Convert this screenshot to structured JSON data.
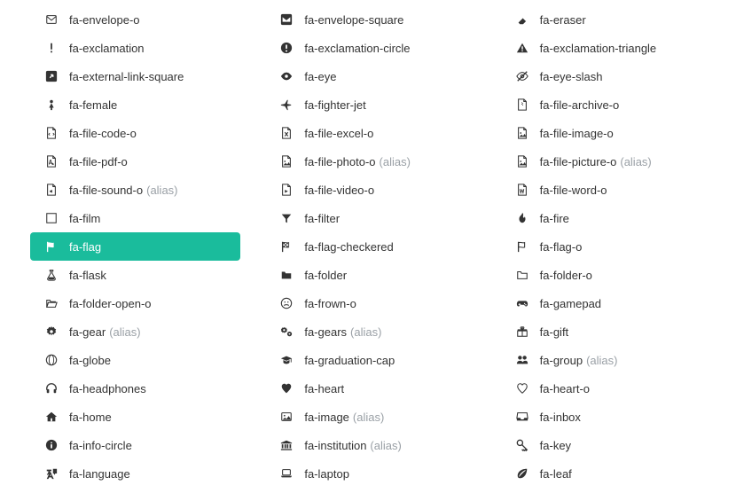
{
  "alias_suffix": "(alias)",
  "columns": [
    [
      {
        "name": "fa-envelope-o",
        "icon": "envelope-o",
        "alias": false,
        "selected": false
      },
      {
        "name": "fa-exclamation",
        "icon": "exclamation",
        "alias": false,
        "selected": false
      },
      {
        "name": "fa-external-link-square",
        "icon": "external-link-square",
        "alias": false,
        "selected": false
      },
      {
        "name": "fa-female",
        "icon": "female",
        "alias": false,
        "selected": false
      },
      {
        "name": "fa-file-code-o",
        "icon": "file-code-o",
        "alias": false,
        "selected": false
      },
      {
        "name": "fa-file-pdf-o",
        "icon": "file-pdf-o",
        "alias": false,
        "selected": false
      },
      {
        "name": "fa-file-sound-o",
        "icon": "file-sound-o",
        "alias": true,
        "selected": false
      },
      {
        "name": "fa-film",
        "icon": "film",
        "alias": false,
        "selected": false
      },
      {
        "name": "fa-flag",
        "icon": "flag",
        "alias": false,
        "selected": true
      },
      {
        "name": "fa-flask",
        "icon": "flask",
        "alias": false,
        "selected": false
      },
      {
        "name": "fa-folder-open-o",
        "icon": "folder-open-o",
        "alias": false,
        "selected": false
      },
      {
        "name": "fa-gear",
        "icon": "gear",
        "alias": true,
        "selected": false
      },
      {
        "name": "fa-globe",
        "icon": "globe",
        "alias": false,
        "selected": false
      },
      {
        "name": "fa-headphones",
        "icon": "headphones",
        "alias": false,
        "selected": false
      },
      {
        "name": "fa-home",
        "icon": "home",
        "alias": false,
        "selected": false
      },
      {
        "name": "fa-info-circle",
        "icon": "info-circle",
        "alias": false,
        "selected": false
      },
      {
        "name": "fa-language",
        "icon": "language",
        "alias": false,
        "selected": false
      }
    ],
    [
      {
        "name": "fa-envelope-square",
        "icon": "envelope-square",
        "alias": false,
        "selected": false
      },
      {
        "name": "fa-exclamation-circle",
        "icon": "exclamation-circle",
        "alias": false,
        "selected": false
      },
      {
        "name": "fa-eye",
        "icon": "eye",
        "alias": false,
        "selected": false
      },
      {
        "name": "fa-fighter-jet",
        "icon": "fighter-jet",
        "alias": false,
        "selected": false
      },
      {
        "name": "fa-file-excel-o",
        "icon": "file-excel-o",
        "alias": false,
        "selected": false
      },
      {
        "name": "fa-file-photo-o",
        "icon": "file-photo-o",
        "alias": true,
        "selected": false
      },
      {
        "name": "fa-file-video-o",
        "icon": "file-video-o",
        "alias": false,
        "selected": false
      },
      {
        "name": "fa-filter",
        "icon": "filter",
        "alias": false,
        "selected": false
      },
      {
        "name": "fa-flag-checkered",
        "icon": "flag-checkered",
        "alias": false,
        "selected": false
      },
      {
        "name": "fa-folder",
        "icon": "folder",
        "alias": false,
        "selected": false
      },
      {
        "name": "fa-frown-o",
        "icon": "frown-o",
        "alias": false,
        "selected": false
      },
      {
        "name": "fa-gears",
        "icon": "gears",
        "alias": true,
        "selected": false
      },
      {
        "name": "fa-graduation-cap",
        "icon": "graduation-cap",
        "alias": false,
        "selected": false
      },
      {
        "name": "fa-heart",
        "icon": "heart",
        "alias": false,
        "selected": false
      },
      {
        "name": "fa-image",
        "icon": "image",
        "alias": true,
        "selected": false
      },
      {
        "name": "fa-institution",
        "icon": "institution",
        "alias": true,
        "selected": false
      },
      {
        "name": "fa-laptop",
        "icon": "laptop",
        "alias": false,
        "selected": false
      }
    ],
    [
      {
        "name": "fa-eraser",
        "icon": "eraser",
        "alias": false,
        "selected": false
      },
      {
        "name": "fa-exclamation-triangle",
        "icon": "exclamation-triangle",
        "alias": false,
        "selected": false
      },
      {
        "name": "fa-eye-slash",
        "icon": "eye-slash",
        "alias": false,
        "selected": false
      },
      {
        "name": "fa-file-archive-o",
        "icon": "file-archive-o",
        "alias": false,
        "selected": false
      },
      {
        "name": "fa-file-image-o",
        "icon": "file-image-o",
        "alias": false,
        "selected": false
      },
      {
        "name": "fa-file-picture-o",
        "icon": "file-picture-o",
        "alias": true,
        "selected": false
      },
      {
        "name": "fa-file-word-o",
        "icon": "file-word-o",
        "alias": false,
        "selected": false
      },
      {
        "name": "fa-fire",
        "icon": "fire",
        "alias": false,
        "selected": false
      },
      {
        "name": "fa-flag-o",
        "icon": "flag-o",
        "alias": false,
        "selected": false
      },
      {
        "name": "fa-folder-o",
        "icon": "folder-o",
        "alias": false,
        "selected": false
      },
      {
        "name": "fa-gamepad",
        "icon": "gamepad",
        "alias": false,
        "selected": false
      },
      {
        "name": "fa-gift",
        "icon": "gift",
        "alias": false,
        "selected": false
      },
      {
        "name": "fa-group",
        "icon": "group",
        "alias": true,
        "selected": false
      },
      {
        "name": "fa-heart-o",
        "icon": "heart-o",
        "alias": false,
        "selected": false
      },
      {
        "name": "fa-inbox",
        "icon": "inbox",
        "alias": false,
        "selected": false
      },
      {
        "name": "fa-key",
        "icon": "key",
        "alias": false,
        "selected": false
      },
      {
        "name": "fa-leaf",
        "icon": "leaf",
        "alias": false,
        "selected": false
      }
    ]
  ]
}
